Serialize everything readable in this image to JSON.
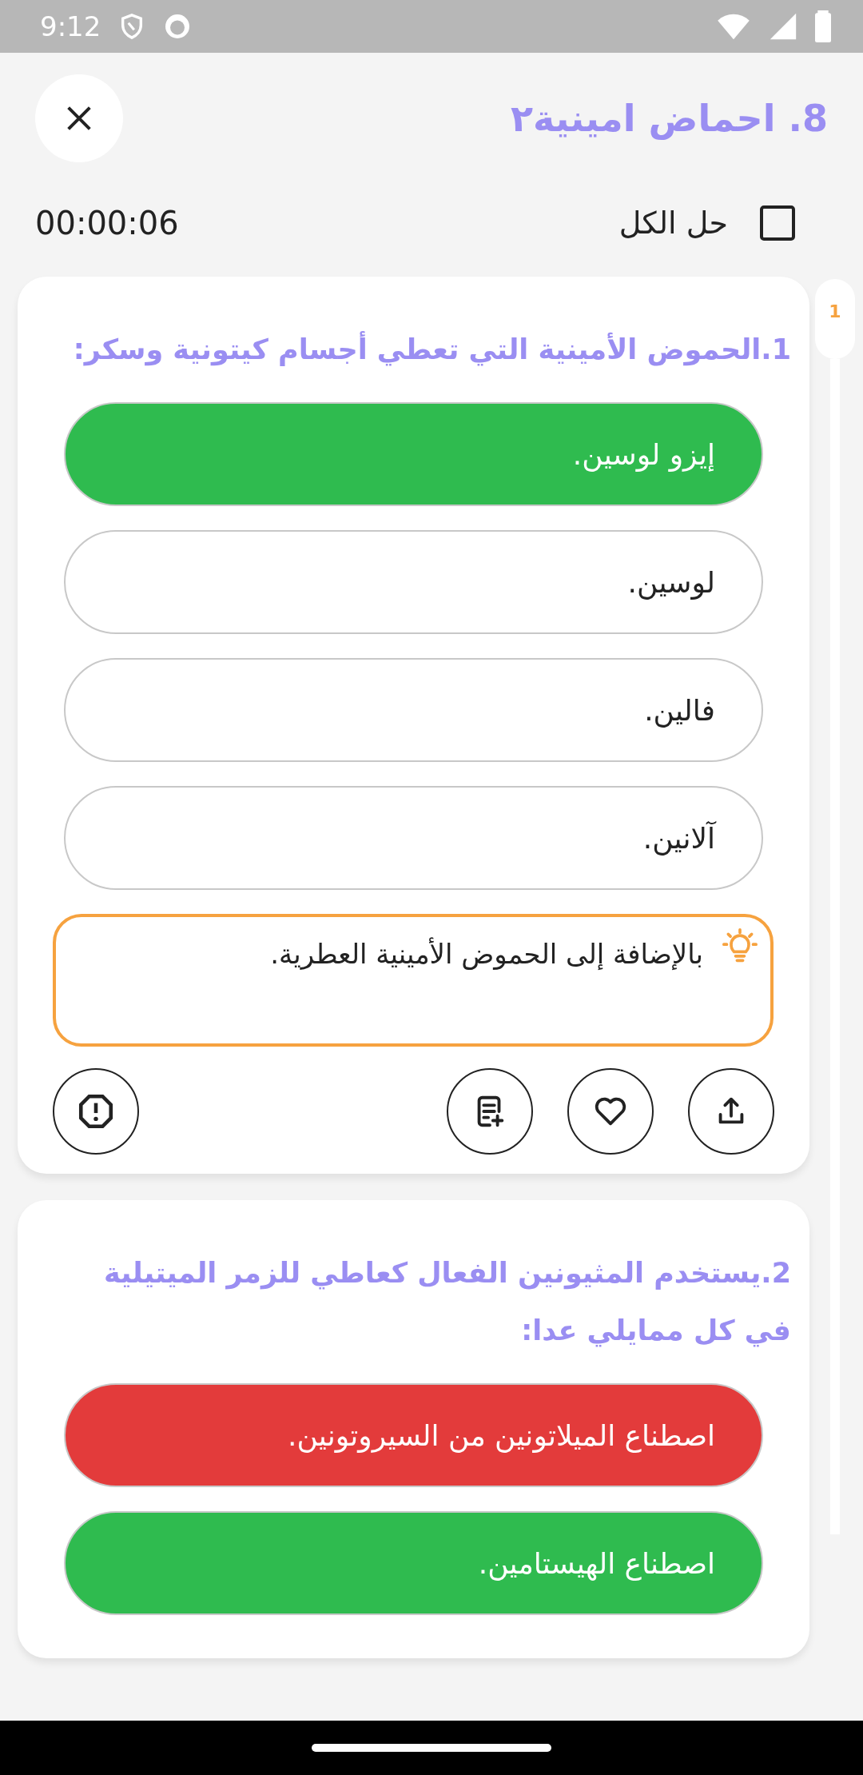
{
  "status_bar": {
    "time": "9:12"
  },
  "header": {
    "title": "8.   احماض امينية٢"
  },
  "toolbar": {
    "timer": "00:00:06",
    "solve_all": {
      "label": "حل الكل",
      "checked": false
    }
  },
  "navigator": [
    {
      "label": "1",
      "selected": true
    }
  ],
  "questions": [
    {
      "text": "1.الحموض الأمينية التي تعطي أجسام كيتونية وسكر:",
      "options": [
        {
          "text": "إيزو لوسين.",
          "kind": "correct"
        },
        {
          "text": "لوسين.",
          "kind": "plain"
        },
        {
          "text": "فالين.",
          "kind": "plain"
        },
        {
          "text": "آلانين.",
          "kind": "plain"
        }
      ],
      "hint": "بالإضافة إلى الحموض الأمينية العطرية.",
      "actions": [
        {
          "kind": "report"
        },
        {
          "kind": "note"
        },
        {
          "kind": "favorite"
        },
        {
          "kind": "share"
        }
      ]
    },
    {
      "text": "2.يستخدم المثيونين الفعال كعاطي للزمر الميتيلية في كل ممايلي عدا:",
      "options": [
        {
          "text": "اصطناع الميلاتونين من السيروتونين.",
          "kind": "wrong"
        },
        {
          "text": "اصطناع  الهيستامين.",
          "kind": "correct"
        }
      ]
    }
  ]
}
